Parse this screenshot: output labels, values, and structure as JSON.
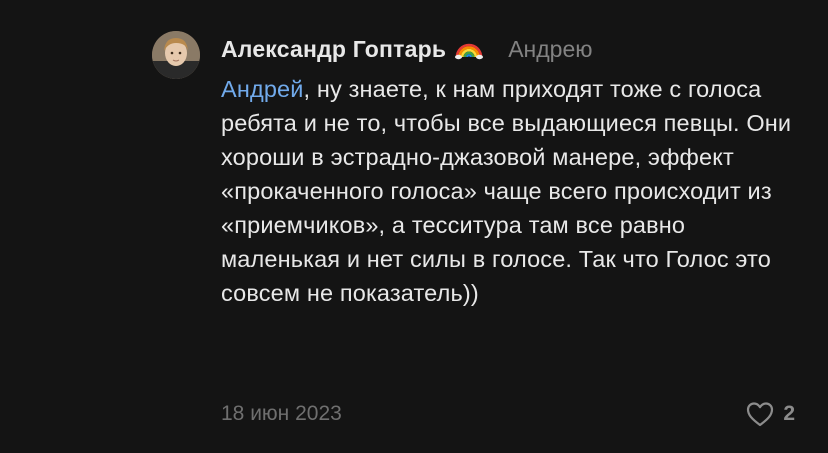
{
  "comment": {
    "author": "Александр Гоптарь",
    "author_badge_icon": "rainbow-icon",
    "reply_to": "Андрею",
    "mention": "Андрей",
    "text_after_mention": ", ну знаете, к нам приходят тоже с голоса ребята и не то, чтобы все выдающиеся певцы. Они хороши в эстрадно-джазовой манере, эффект «прокаченного голоса» чаще всего происходит из «приемчиков», а тесситура там все равно маленькая и нет силы в голосе. Так что Голос это совсем не показатель))",
    "date": "18 июн 2023",
    "like_icon": "heart-icon",
    "likes": "2"
  },
  "colors": {
    "background": "#141414",
    "text": "#e8e8e8",
    "mention": "#71aaeb",
    "muted": "#828282"
  }
}
